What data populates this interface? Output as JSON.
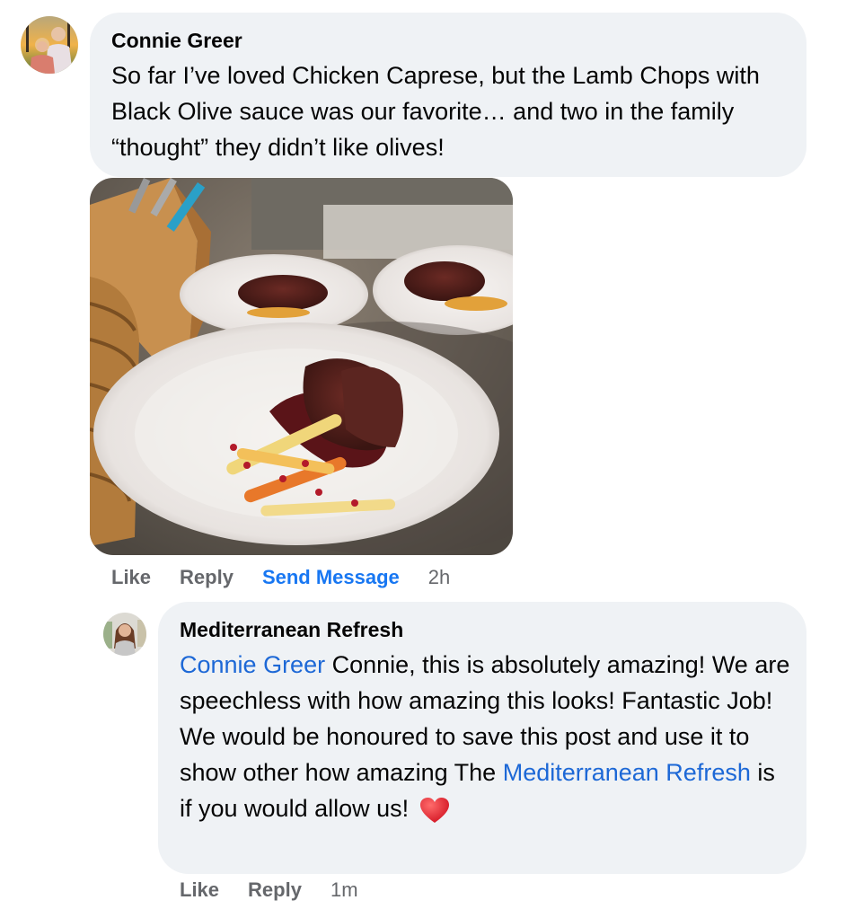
{
  "comments": [
    {
      "author": "Connie Greer",
      "avatar_icon": "couple-profile-photo",
      "text": "So far I’ve loved Chicken Caprese, but the Lamb Chops with Black Olive sauce was our favorite… and two in the family “thought” they didn’t like olives!",
      "attachment": {
        "type": "photo",
        "description": "Plated lamb chops with dark olive sauce, roasted carrots and parsnips with pomegranate seeds; two more plates and a knife block in background"
      },
      "actions": {
        "like": "Like",
        "reply": "Reply",
        "send_message": "Send Message",
        "time": "2h"
      }
    },
    {
      "author": "Mediterranean Refresh",
      "avatar_icon": "woman-profile-photo",
      "mention": "Connie Greer",
      "text_part1": " Connie, this is absolutely amazing! We are speechless with how amazing this looks! Fantastic Job! We would be honoured to save this post and use it to show other how amazing The ",
      "mention2": "Mediterranean Refresh",
      "text_part2": " is if you would allow us! ",
      "emoji": "red-heart",
      "actions": {
        "like": "Like",
        "reply": "Reply",
        "time": "1m"
      }
    }
  ],
  "colors": {
    "bubble": "#eff2f5",
    "link": "#1d68d6",
    "action_gray": "#65676b",
    "send_message_blue": "#1877f2",
    "heart": "#e0242f"
  }
}
